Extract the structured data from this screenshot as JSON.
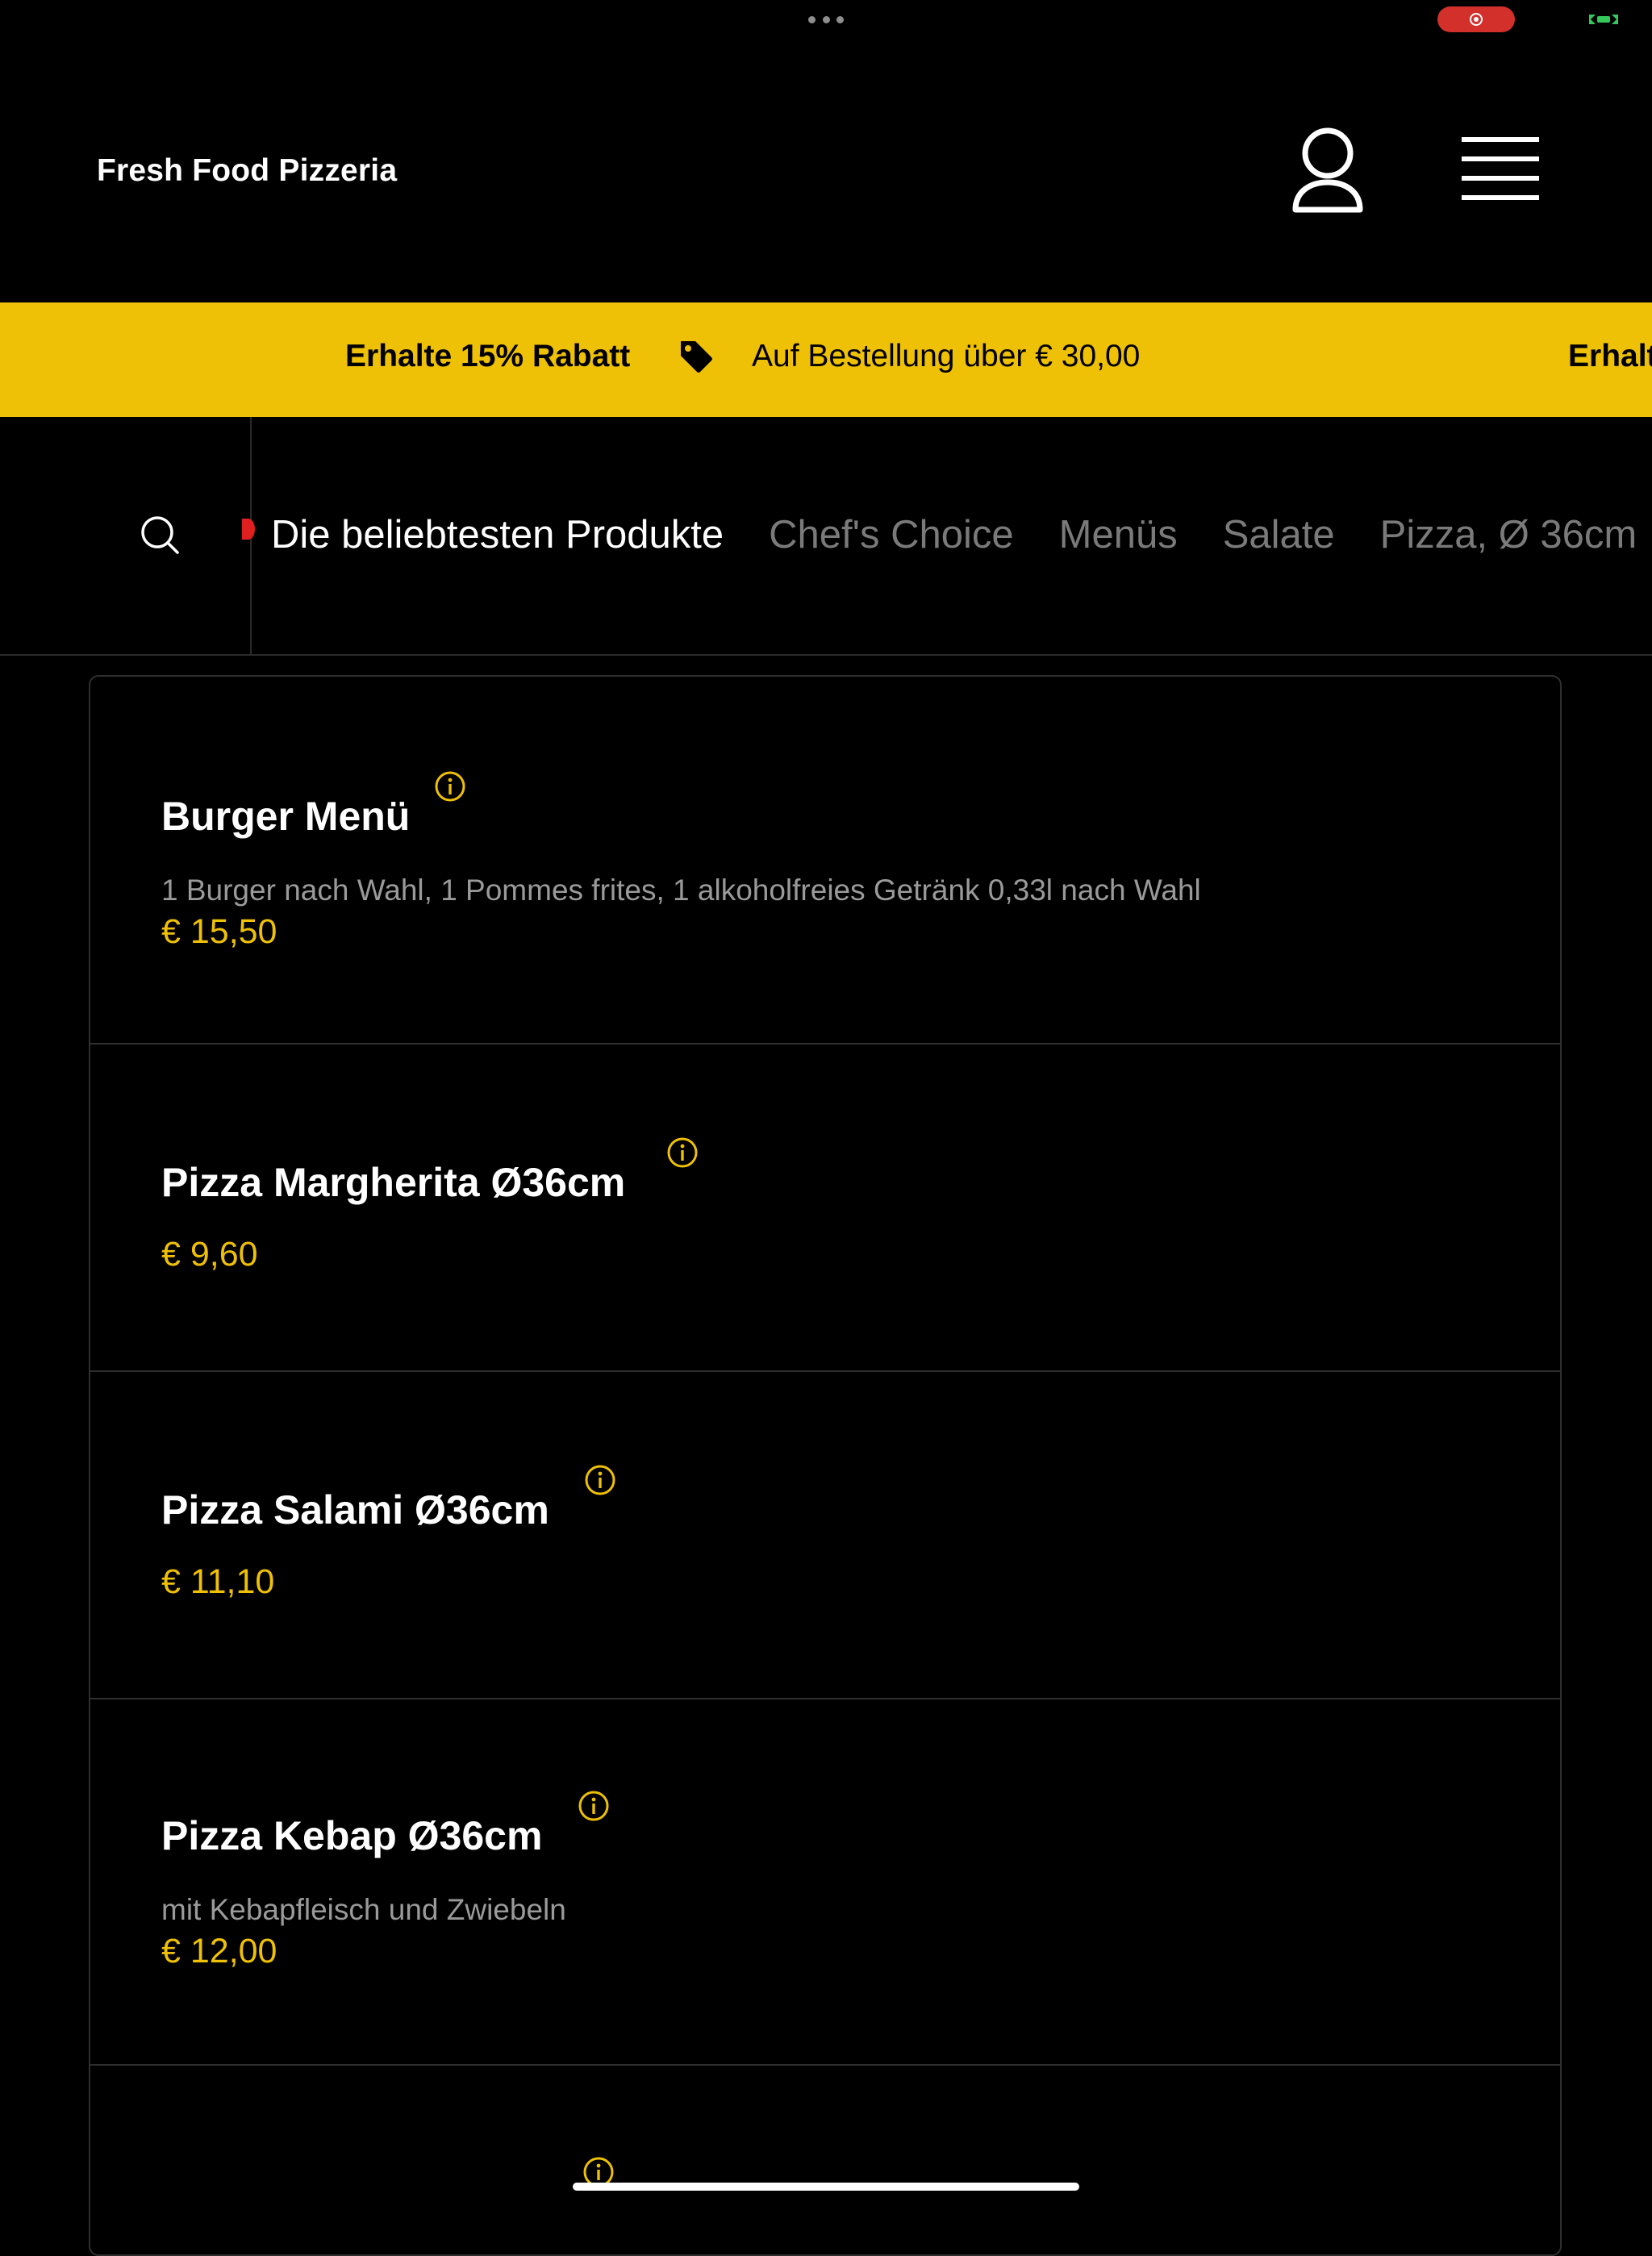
{
  "header": {
    "brand": "Fresh Food Pizzeria"
  },
  "promo": {
    "headline": "Erhalte 15% Rabatt",
    "detail": "Auf Bestellung über € 30,00",
    "headline_repeat": "Erhalte 15% Rabatt"
  },
  "nav": {
    "tabs": [
      {
        "label": "Die beliebtesten Produkte",
        "active": true
      },
      {
        "label": "Chef's Choice",
        "active": false
      },
      {
        "label": "Menüs",
        "active": false
      },
      {
        "label": "Salate",
        "active": false
      },
      {
        "label": "Pizza, Ø 36cm",
        "active": false
      }
    ]
  },
  "products": [
    {
      "name": "Burger Menü",
      "description": "1 Burger nach Wahl, 1 Pommes frites, 1 alkoholfreies Getränk 0,33l nach Wahl",
      "price": "€ 15,50"
    },
    {
      "name": "Pizza Margherita Ø36cm",
      "description": "",
      "price": "€ 9,60"
    },
    {
      "name": "Pizza Salami Ø36cm",
      "description": "",
      "price": "€ 11,10"
    },
    {
      "name": "Pizza Kebap Ø36cm",
      "description": "mit Kebapfleisch und Zwiebeln",
      "price": "€ 12,00"
    }
  ],
  "colors": {
    "accent": "#eec006",
    "background": "#000000",
    "record": "#d3302b"
  },
  "icons": {
    "account": "user-icon",
    "menu": "hamburger-menu-icon",
    "promo": "tag-icon",
    "search": "search-icon",
    "info": "info-icon"
  }
}
